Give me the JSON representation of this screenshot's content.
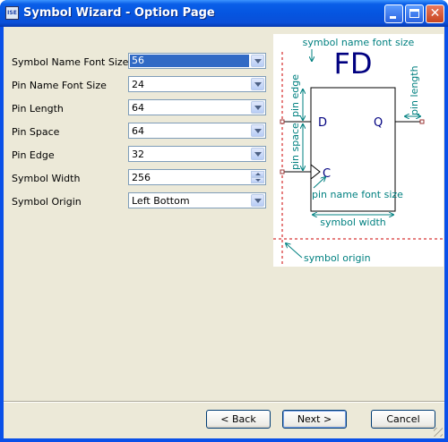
{
  "window": {
    "title": "Symbol Wizard - Option Page",
    "app_icon_text": "ISE"
  },
  "fields": [
    {
      "label": "Symbol Name Font Size",
      "value": "56",
      "control": "dropdown",
      "selected": true
    },
    {
      "label": "Pin Name Font Size",
      "value": "24",
      "control": "dropdown",
      "selected": false
    },
    {
      "label": "Pin Length",
      "value": "64",
      "control": "dropdown",
      "selected": false
    },
    {
      "label": "Pin Space",
      "value": "64",
      "control": "dropdown",
      "selected": false
    },
    {
      "label": "Pin Edge",
      "value": "32",
      "control": "dropdown",
      "selected": false
    },
    {
      "label": "Symbol Width",
      "value": "256",
      "control": "spinner",
      "selected": false
    },
    {
      "label": "Symbol Origin",
      "value": "Left Bottom",
      "control": "dropdown",
      "selected": false
    }
  ],
  "diagram": {
    "symbol_name": "FD",
    "pin_d": "D",
    "pin_q": "Q",
    "pin_c": "C",
    "labels": {
      "symbol_name_font_size": "symbol name font size",
      "pin_edge": "pin edge",
      "pin_space": "pin space",
      "pin_length": "pin length",
      "pin_name_font_size": "pin name font size",
      "symbol_width": "symbol width",
      "symbol_origin": "symbol origin"
    },
    "colors": {
      "annotation": "#008080",
      "symbol": "#000080",
      "guide": "#cc0000",
      "pin_end": "#993333"
    }
  },
  "buttons": {
    "back": "< Back",
    "next": "Next >",
    "cancel": "Cancel"
  }
}
